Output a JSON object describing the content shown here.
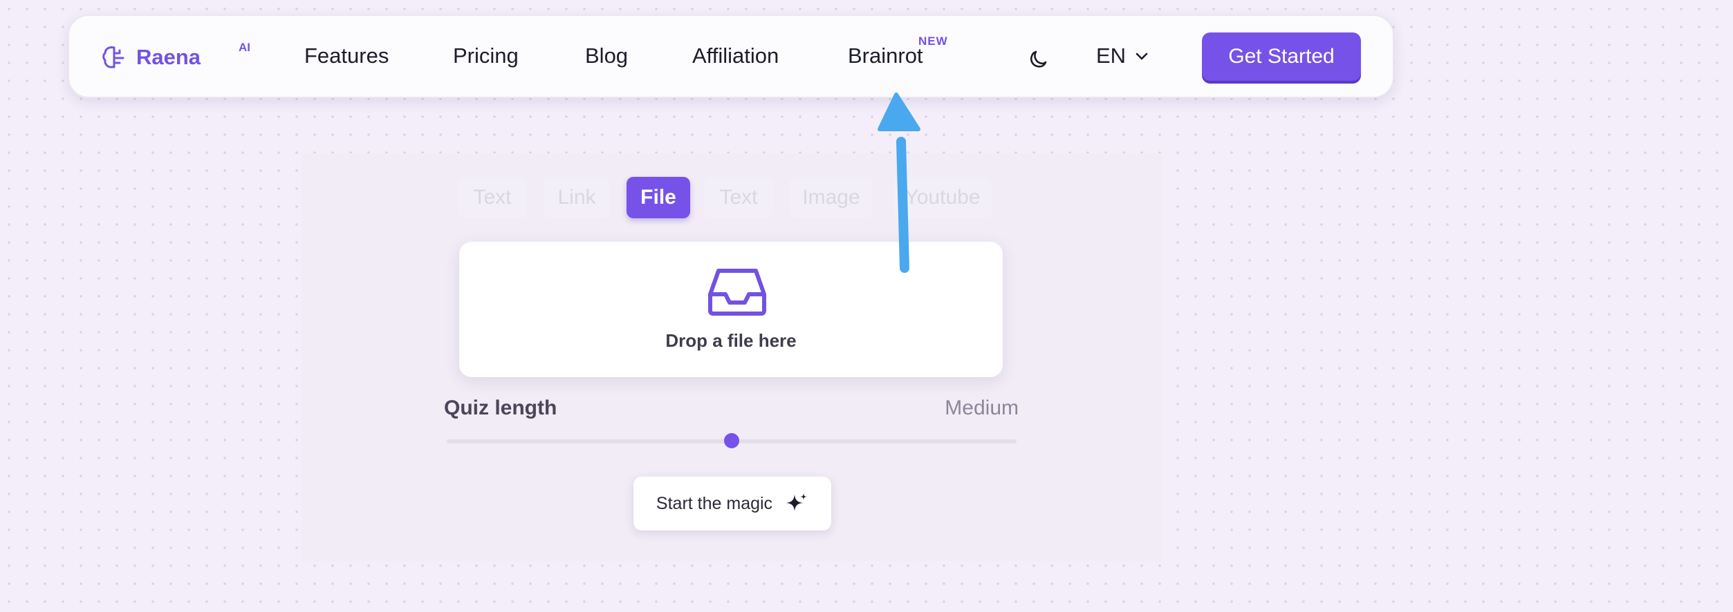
{
  "navbar": {
    "logo_text": "Raena",
    "logo_superscript": "AI",
    "links": [
      {
        "label": "Features"
      },
      {
        "label": "Pricing"
      },
      {
        "label": "Blog"
      },
      {
        "label": "Affiliation"
      },
      {
        "label": "Brainrot",
        "badge": "NEW"
      }
    ],
    "language": "EN",
    "cta_label": "Get Started"
  },
  "demo": {
    "tabs": [
      {
        "label": "Text",
        "active": false
      },
      {
        "label": "Link",
        "active": false
      },
      {
        "label": "File",
        "active": true
      },
      {
        "label": "Text",
        "active": false
      },
      {
        "label": "Image",
        "active": false
      },
      {
        "label": "Youtube",
        "active": false
      }
    ],
    "drop_label": "Drop a file here",
    "quiz_length_label": "Quiz length",
    "quiz_length_value": "Medium",
    "slider_level": 0.5,
    "start_button_label": "Start the magic"
  },
  "colors": {
    "brand": "#7652e8",
    "background": "#f3eefa",
    "annotation_arrow": "#4aa8ee"
  }
}
